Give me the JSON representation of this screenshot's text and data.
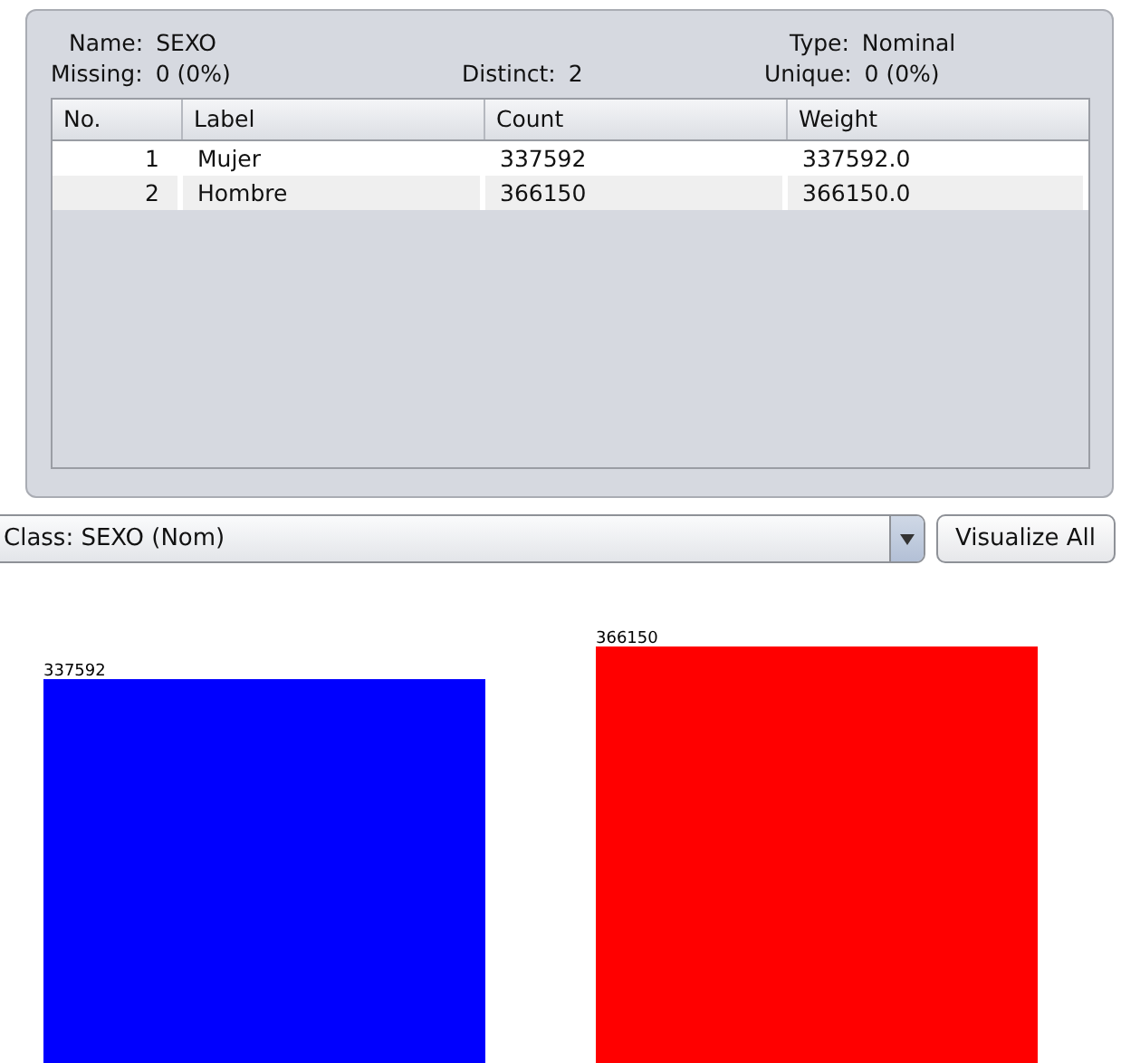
{
  "attribute": {
    "name_label": "Name:",
    "name": "SEXO",
    "type_label": "Type:",
    "type": "Nominal",
    "missing_label": "Missing:",
    "missing": "0 (0%)",
    "distinct_label": "Distinct:",
    "distinct": "2",
    "unique_label": "Unique:",
    "unique": "0 (0%)"
  },
  "table": {
    "columns": [
      "No.",
      "Label",
      "Count",
      "Weight"
    ],
    "rows": [
      {
        "no": "1",
        "label": "Mujer",
        "count": "337592",
        "weight": "337592.0"
      },
      {
        "no": "2",
        "label": "Hombre",
        "count": "366150",
        "weight": "366150.0"
      }
    ]
  },
  "class_select": {
    "value": "Class: SEXO (Nom)"
  },
  "visualize_button": "Visualize All",
  "chart": {
    "chart_data": {
      "type": "bar",
      "data_labels": true,
      "categories": [
        null,
        null
      ],
      "series": [
        {
          "colors": [
            "#0000ff",
            "#ff0000"
          ],
          "values": [
            337592,
            366150
          ]
        }
      ]
    }
  }
}
